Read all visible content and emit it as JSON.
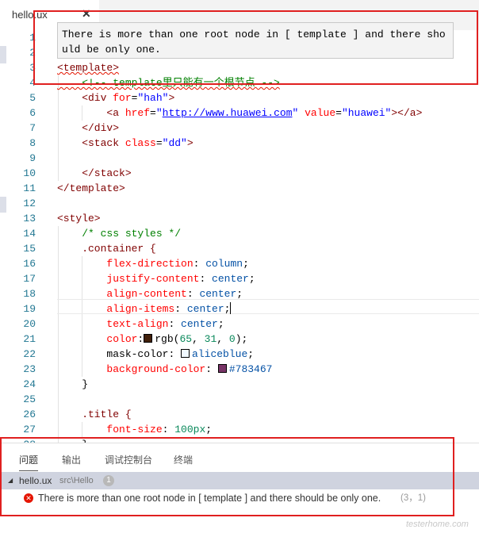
{
  "tab": {
    "filename": "hello.ux",
    "close_glyph": "✕"
  },
  "hover": {
    "message": "There is more than one root node in [ template ] and there should be only one."
  },
  "lines": [
    {
      "n": "1",
      "segments": []
    },
    {
      "n": "2",
      "segments": []
    },
    {
      "n": "3",
      "segments": [
        {
          "t": "<template>",
          "c": "k-tag squiggle"
        }
      ]
    },
    {
      "n": "4",
      "segments": [
        {
          "t": "    <!-- template里只能有一个根节点 -->",
          "c": "k-comment squiggle"
        }
      ]
    },
    {
      "n": "5",
      "segments": [
        {
          "t": "    <div ",
          "c": "k-tag"
        },
        {
          "t": "for",
          "c": "k-attr"
        },
        {
          "t": "=",
          "c": "k-punct"
        },
        {
          "t": "\"hah\"",
          "c": "k-str"
        },
        {
          "t": ">",
          "c": "k-tag"
        }
      ]
    },
    {
      "n": "6",
      "segments": [
        {
          "t": "        <a ",
          "c": "k-tag"
        },
        {
          "t": "href",
          "c": "k-attr"
        },
        {
          "t": "=",
          "c": "k-punct"
        },
        {
          "t": "\"",
          "c": "k-str"
        },
        {
          "t": "http://www.huawei.com",
          "c": "k-link"
        },
        {
          "t": "\"",
          "c": "k-str"
        },
        {
          "t": " value",
          "c": "k-attr"
        },
        {
          "t": "=",
          "c": "k-punct"
        },
        {
          "t": "\"huawei\"",
          "c": "k-str"
        },
        {
          "t": "></a>",
          "c": "k-tag"
        }
      ]
    },
    {
      "n": "7",
      "segments": [
        {
          "t": "    </div>",
          "c": "k-tag"
        }
      ]
    },
    {
      "n": "8",
      "segments": [
        {
          "t": "    <stack ",
          "c": "k-tag"
        },
        {
          "t": "class",
          "c": "k-attr"
        },
        {
          "t": "=",
          "c": "k-punct"
        },
        {
          "t": "\"dd\"",
          "c": "k-str"
        },
        {
          "t": ">",
          "c": "k-tag"
        }
      ]
    },
    {
      "n": "9",
      "segments": []
    },
    {
      "n": "10",
      "segments": [
        {
          "t": "    </stack>",
          "c": "k-tag"
        }
      ]
    },
    {
      "n": "11",
      "segments": [
        {
          "t": "</template>",
          "c": "k-tag"
        }
      ]
    },
    {
      "n": "12",
      "segments": []
    },
    {
      "n": "13",
      "segments": [
        {
          "t": "<style>",
          "c": "k-tag"
        }
      ]
    },
    {
      "n": "14",
      "segments": [
        {
          "t": "    /* css styles */",
          "c": "k-comment"
        }
      ]
    },
    {
      "n": "15",
      "segments": [
        {
          "t": "    .container {",
          "c": "k-tag"
        }
      ]
    },
    {
      "n": "16",
      "segments": [
        {
          "t": "        flex-direction",
          "c": "k-prop"
        },
        {
          "t": ": ",
          "c": "k-punct"
        },
        {
          "t": "column",
          "c": "k-val"
        },
        {
          "t": ";",
          "c": "k-punct"
        }
      ]
    },
    {
      "n": "17",
      "segments": [
        {
          "t": "        justify-content",
          "c": "k-prop"
        },
        {
          "t": ": ",
          "c": "k-punct"
        },
        {
          "t": "center",
          "c": "k-val"
        },
        {
          "t": ";",
          "c": "k-punct"
        }
      ]
    },
    {
      "n": "18",
      "segments": [
        {
          "t": "        align-content",
          "c": "k-prop"
        },
        {
          "t": ": ",
          "c": "k-punct"
        },
        {
          "t": "center",
          "c": "k-val"
        },
        {
          "t": ";",
          "c": "k-punct"
        }
      ]
    },
    {
      "n": "19",
      "segments": [
        {
          "t": "        align-items",
          "c": "k-prop"
        },
        {
          "t": ": ",
          "c": "k-punct"
        },
        {
          "t": "center",
          "c": "k-val"
        },
        {
          "t": ";",
          "c": "k-punct"
        },
        {
          "caret": true
        }
      ]
    },
    {
      "n": "20",
      "segments": [
        {
          "t": "        text-align",
          "c": "k-prop"
        },
        {
          "t": ": ",
          "c": "k-punct"
        },
        {
          "t": "center",
          "c": "k-val"
        },
        {
          "t": ";",
          "c": "k-punct"
        }
      ]
    },
    {
      "n": "21",
      "segments": [
        {
          "t": "        color",
          "c": "k-prop"
        },
        {
          "t": ":",
          "c": "k-punct"
        },
        {
          "swatch": "#41200a"
        },
        {
          "t": "rgb(",
          "c": "k-punct"
        },
        {
          "t": "65",
          "c": "k-num"
        },
        {
          "t": ", ",
          "c": "k-punct"
        },
        {
          "t": "31",
          "c": "k-num"
        },
        {
          "t": ", ",
          "c": "k-punct"
        },
        {
          "t": "0",
          "c": "k-num"
        },
        {
          "t": ");",
          "c": "k-punct"
        }
      ]
    },
    {
      "n": "22",
      "segments": [
        {
          "t": "        mask-color",
          "c": "k-punct"
        },
        {
          "t": ": ",
          "c": "k-punct"
        },
        {
          "swatch": "#f0f8ff"
        },
        {
          "t": "aliceblue",
          "c": "k-val"
        },
        {
          "t": ";",
          "c": "k-punct"
        }
      ]
    },
    {
      "n": "23",
      "segments": [
        {
          "t": "        background-color",
          "c": "k-prop"
        },
        {
          "t": ": ",
          "c": "k-punct"
        },
        {
          "swatch": "#783467"
        },
        {
          "t": "#783467",
          "c": "k-val"
        }
      ]
    },
    {
      "n": "24",
      "segments": [
        {
          "t": "    }",
          "c": "k-punct"
        }
      ]
    },
    {
      "n": "25",
      "segments": []
    },
    {
      "n": "26",
      "segments": [
        {
          "t": "    .title {",
          "c": "k-tag"
        }
      ]
    },
    {
      "n": "27",
      "segments": [
        {
          "t": "        font-size",
          "c": "k-prop"
        },
        {
          "t": ": ",
          "c": "k-punct"
        },
        {
          "t": "100px",
          "c": "k-num"
        },
        {
          "t": ";",
          "c": "k-punct"
        }
      ]
    },
    {
      "n": "28",
      "segments": [
        {
          "t": "    }",
          "c": "k-punct"
        }
      ]
    }
  ],
  "panel": {
    "tabs": [
      "问题",
      "输出",
      "调试控制台",
      "终端"
    ],
    "group": {
      "filename": "hello.ux",
      "path": "src\\Hello",
      "count": "1"
    },
    "problem": {
      "message": "There is more than one root node in [ template ] and there should be only one.",
      "location": "(3，1)"
    }
  },
  "watermark": "testerhome.com"
}
